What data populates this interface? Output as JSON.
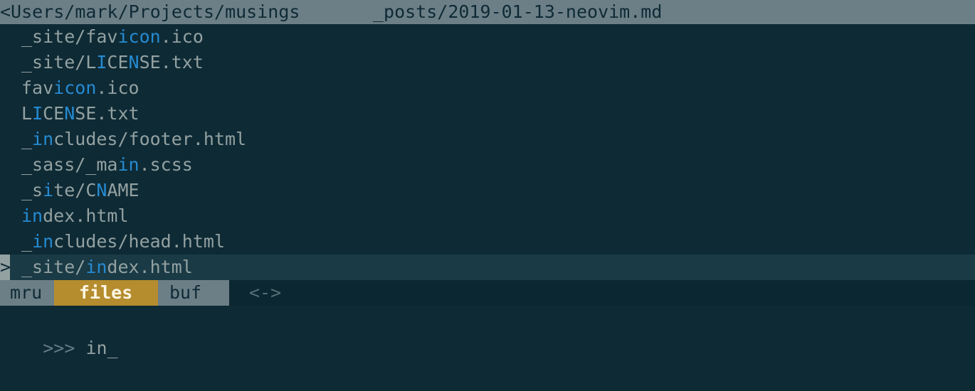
{
  "topbar": {
    "cwd": "<Users/mark/Projects/musings",
    "file": "_posts/2019-01-13-neovim.md"
  },
  "results": [
    {
      "segments": [
        {
          "t": "_site/fav",
          "m": false
        },
        {
          "t": "i",
          "m": true
        },
        {
          "t": "con",
          "m": true
        },
        {
          "t": ".ico",
          "m": false
        }
      ]
    },
    {
      "segments": [
        {
          "t": "_site/L",
          "m": false
        },
        {
          "t": "I",
          "m": true
        },
        {
          "t": "CE",
          "m": false
        },
        {
          "t": "N",
          "m": true
        },
        {
          "t": "SE.txt",
          "m": false
        }
      ]
    },
    {
      "segments": [
        {
          "t": "fav",
          "m": false
        },
        {
          "t": "i",
          "m": true
        },
        {
          "t": "con",
          "m": true
        },
        {
          "t": ".ico",
          "m": false
        }
      ]
    },
    {
      "segments": [
        {
          "t": "L",
          "m": false
        },
        {
          "t": "I",
          "m": true
        },
        {
          "t": "CE",
          "m": false
        },
        {
          "t": "N",
          "m": true
        },
        {
          "t": "SE.txt",
          "m": false
        }
      ]
    },
    {
      "segments": [
        {
          "t": "_",
          "m": false
        },
        {
          "t": "in",
          "m": true
        },
        {
          "t": "cludes/footer.html",
          "m": false
        }
      ]
    },
    {
      "segments": [
        {
          "t": "_sass/_ma",
          "m": false
        },
        {
          "t": "in",
          "m": true
        },
        {
          "t": ".scss",
          "m": false
        }
      ]
    },
    {
      "segments": [
        {
          "t": "_s",
          "m": false
        },
        {
          "t": "i",
          "m": true
        },
        {
          "t": "te/C",
          "m": false
        },
        {
          "t": "N",
          "m": true
        },
        {
          "t": "AME",
          "m": false
        }
      ]
    },
    {
      "segments": [
        {
          "t": "in",
          "m": true
        },
        {
          "t": "dex.html",
          "m": false
        }
      ]
    },
    {
      "segments": [
        {
          "t": "_",
          "m": false
        },
        {
          "t": "in",
          "m": true
        },
        {
          "t": "cludes/head.html",
          "m": false
        }
      ]
    },
    {
      "segments": [
        {
          "t": "_site/",
          "m": false
        },
        {
          "t": "in",
          "m": true
        },
        {
          "t": "dex.html",
          "m": false
        }
      ],
      "selected": true
    }
  ],
  "selection_marker": ">",
  "statusline": {
    "tabs": [
      {
        "label": "mru",
        "active": false
      },
      {
        "label": "files",
        "active": true
      },
      {
        "label": "buf",
        "active": false
      }
    ],
    "arrows": "<->"
  },
  "prompt": {
    "symbol": ">>> ",
    "query": "in",
    "cursor": "_"
  },
  "colors": {
    "background": "#0e2a35",
    "match": "#268bd2",
    "text": "#93a1a1",
    "active_tab": "#b58c2e",
    "bar": "#6c7f87"
  }
}
